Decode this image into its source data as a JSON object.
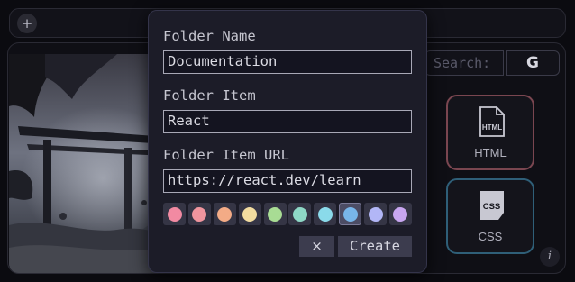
{
  "toolbar": {
    "add_label": "+"
  },
  "search": {
    "label": "Search:",
    "engine_label": "G"
  },
  "shortcuts": [
    {
      "label": "HTML",
      "icon_text": "HTML",
      "icon": "html-file-icon",
      "color": "#7a4650"
    },
    {
      "label": "CSS",
      "icon_text": "CSS",
      "icon": "css-file-icon",
      "color": "#2f5f78"
    }
  ],
  "info": {
    "label": "i"
  },
  "dialog": {
    "folder_name_label": "Folder Name",
    "folder_name_value": "Documentation",
    "folder_item_label": "Folder Item",
    "folder_item_value": "React",
    "folder_item_url_label": "Folder Item URL",
    "folder_item_url_value": "https://react.dev/learn",
    "colors": [
      "#f28aa2",
      "#f0959e",
      "#f3ab86",
      "#f2dca0",
      "#a8dc94",
      "#8ed8c6",
      "#8adaea",
      "#78b6ea",
      "#b2b6f6",
      "#c8a6f0"
    ],
    "selected_color_index": 7,
    "cancel_label": "×",
    "create_label": "Create"
  }
}
